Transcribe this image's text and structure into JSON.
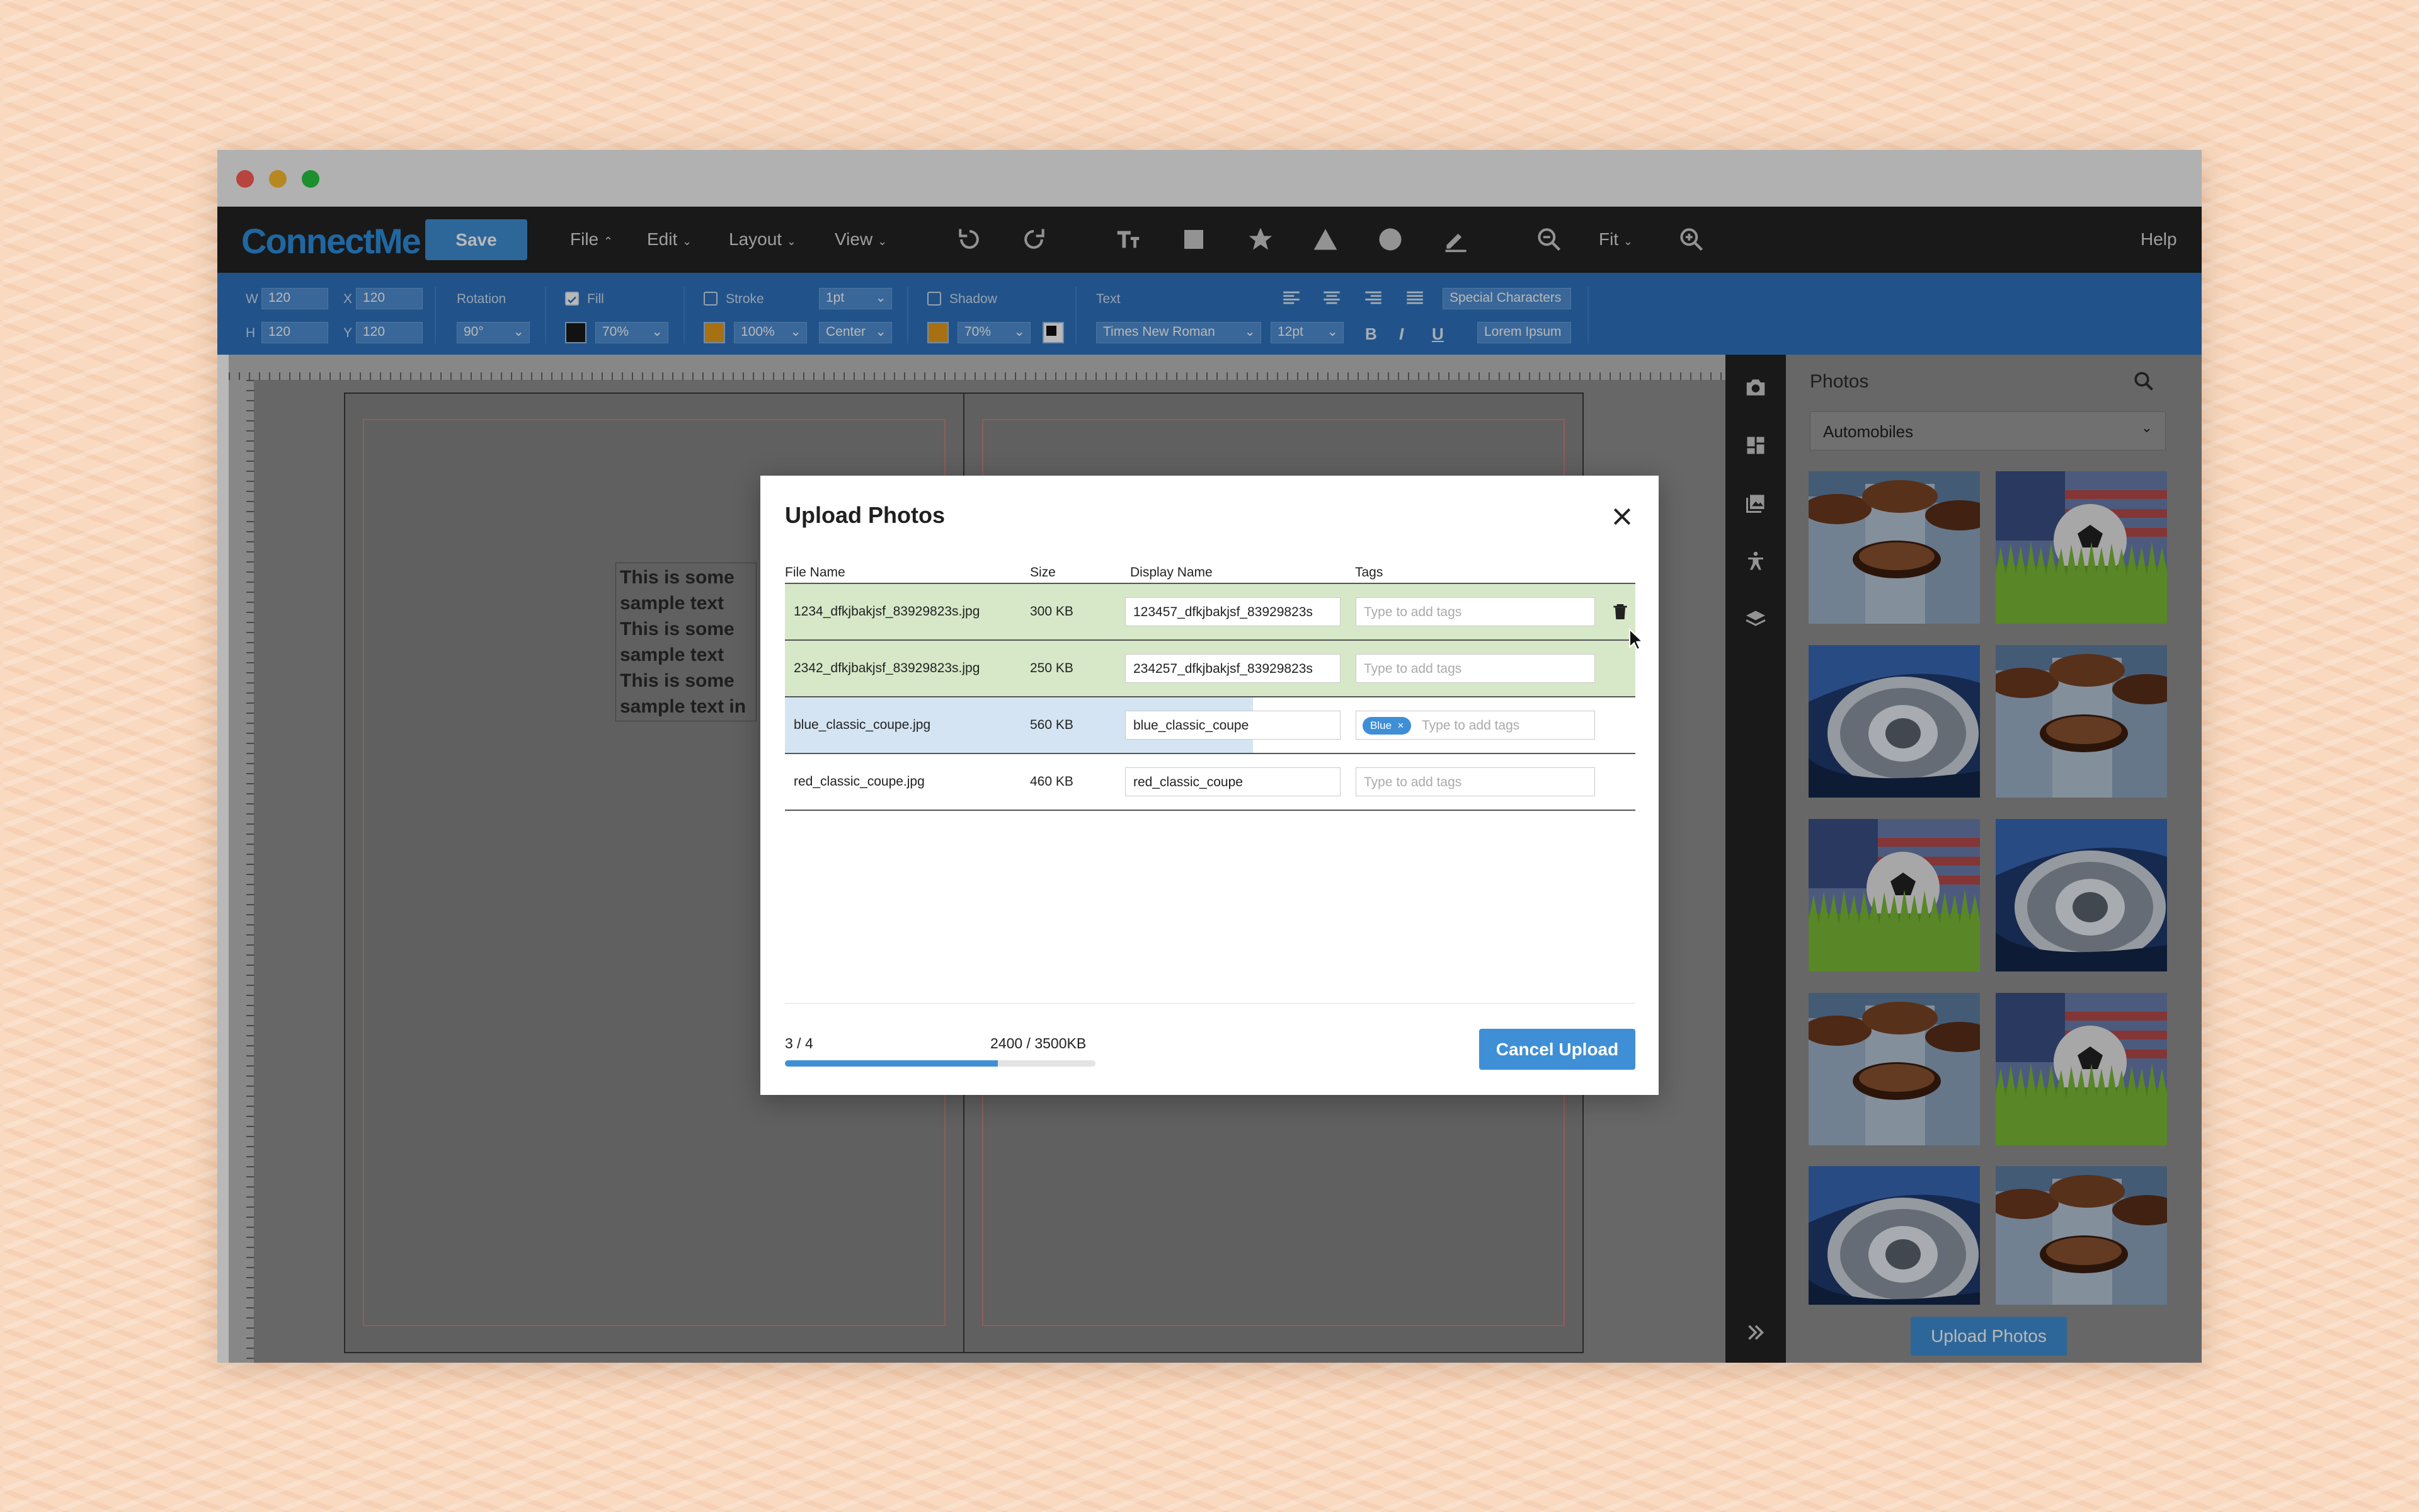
{
  "app": {
    "name": "ConnectMe",
    "help_label": "Help"
  },
  "menubar": {
    "save_label": "Save",
    "menus": [
      "File",
      "Edit",
      "Layout",
      "View"
    ],
    "zoom_label": "Fit"
  },
  "toolbar": {
    "w_label": "W",
    "w_value": "120",
    "h_label": "H",
    "h_value": "120",
    "x_label": "X",
    "x_value": "120",
    "y_label": "Y",
    "y_value": "120",
    "rotation_label": "Rotation",
    "rotation_value": "90°",
    "fill_label": "Fill",
    "fill_opacity": "70%",
    "fill_color": "#1a1a1a",
    "stroke_label": "Stroke",
    "stroke_width": "1pt",
    "stroke_opacity": "100%",
    "stroke_align": "Center",
    "stroke_color": "#e89b1a",
    "shadow_label": "Shadow",
    "shadow_opacity": "70%",
    "shadow_color": "#e89b1a",
    "text_label": "Text",
    "font_value": "Times New Roman",
    "font_size": "12pt",
    "special_chars_label": "Special Characters",
    "lorem_label": "Lorem Ipsum",
    "bold_label": "B",
    "italic_label": "I",
    "underline_label": "U"
  },
  "canvas": {
    "sample_text": "This is some sample text This is some sample text This is some sample text in"
  },
  "photos_panel": {
    "title": "Photos",
    "category": "Automobiles",
    "upload_label": "Upload Photos"
  },
  "modal": {
    "title": "Upload Photos",
    "columns": {
      "file_name": "File Name",
      "size": "Size",
      "display_name": "Display Name",
      "tags": "Tags"
    },
    "tags_placeholder": "Type to add tags",
    "rows": [
      {
        "file": "1234_dfkjbakjsf_83929823s.jpg",
        "size": "300 KB",
        "display": "123457_dfkjbakjsf_83929823s",
        "tag": "",
        "progress": 1.0,
        "status": "done"
      },
      {
        "file": "2342_dfkjbakjsf_83929823s.jpg",
        "size": "250 KB",
        "display": "234257_dfkjbakjsf_83929823s",
        "tag": "",
        "progress": 1.0,
        "status": "done"
      },
      {
        "file": "blue_classic_coupe.jpg",
        "size": "560 KB",
        "display": "blue_classic_coupe",
        "tag": "Blue",
        "progress": 0.55,
        "status": "uploading"
      },
      {
        "file": "red_classic_coupe.jpg",
        "size": "460 KB",
        "display": "red_classic_coupe",
        "tag": "",
        "progress": 0,
        "status": "pending"
      }
    ],
    "count": "3 / 4",
    "bytes": "2400 / 3500KB",
    "overall_progress": 0.686,
    "cancel_label": "Cancel Upload"
  },
  "colors": {
    "accent": "#3f8fd6",
    "done_row": "#d6e8c8",
    "uploading_row": "#d4e4f2"
  }
}
